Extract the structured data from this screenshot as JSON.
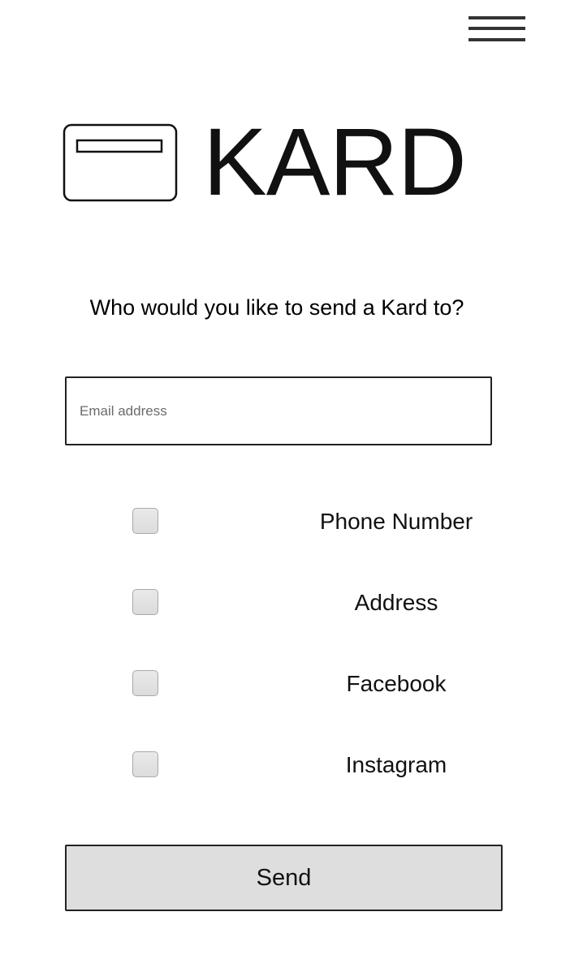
{
  "header": {
    "menu_icon": "hamburger-menu-icon"
  },
  "logo": {
    "icon": "card-icon",
    "text": "KARD"
  },
  "prompt": {
    "text": "Who would you like to send a Kard to?"
  },
  "email": {
    "placeholder": "Email address",
    "value": ""
  },
  "options": [
    {
      "label": "Phone Number",
      "checked": false
    },
    {
      "label": "Address",
      "checked": false
    },
    {
      "label": "Facebook",
      "checked": false
    },
    {
      "label": "Instagram",
      "checked": false
    }
  ],
  "send": {
    "label": "Send"
  },
  "colors": {
    "background": "#ffffff",
    "text": "#000000",
    "button_fill": "#dedede",
    "border": "#222222"
  }
}
